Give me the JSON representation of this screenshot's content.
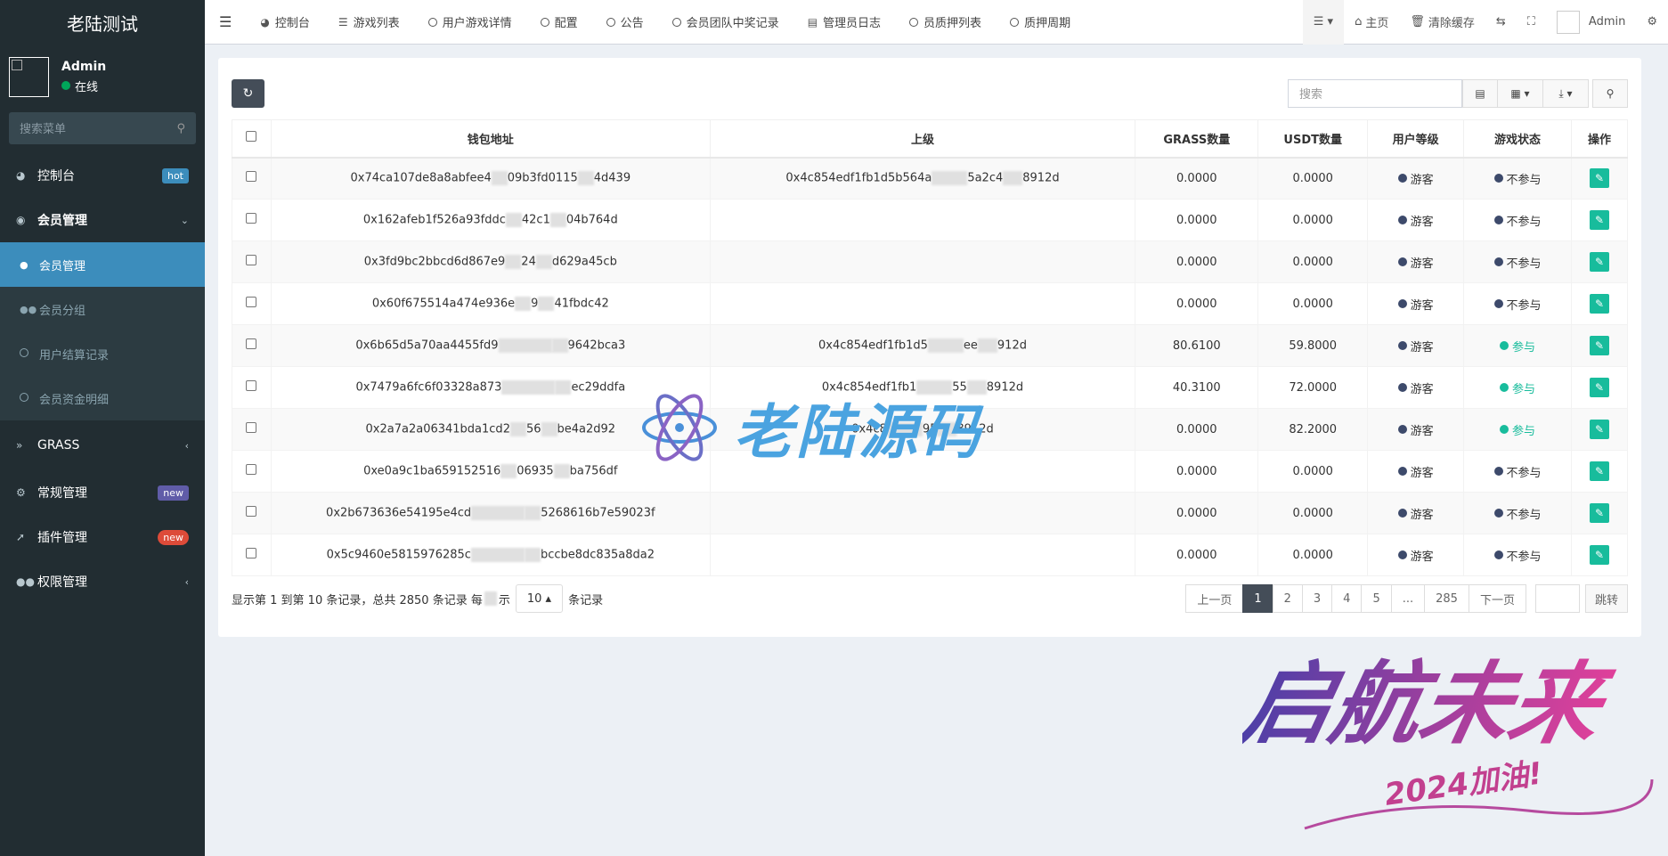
{
  "brand": "老陆测试",
  "user": {
    "name": "Admin",
    "status": "在线"
  },
  "side_search_placeholder": "搜索菜单",
  "sidebar": {
    "dashboard": {
      "label": "控制台",
      "badge": "hot"
    },
    "member_mgmt": {
      "label": "会员管理"
    },
    "sub": [
      {
        "label": "会员管理"
      },
      {
        "label": "会员分组"
      },
      {
        "label": "用户结算记录"
      },
      {
        "label": "会员资金明细"
      }
    ],
    "grass": {
      "label": "GRASS"
    },
    "general": {
      "label": "常规管理",
      "badge": "new"
    },
    "plugins": {
      "label": "插件管理",
      "badge": "new"
    },
    "permissions": {
      "label": "权限管理"
    }
  },
  "tabs": [
    "控制台",
    "游戏列表",
    "用户游戏详情",
    "配置",
    "公告",
    "会员团队中奖记录",
    "管理员日志",
    "员质押列表",
    "质押周期"
  ],
  "topright": {
    "home": "主页",
    "clear_cache": "清除缓存",
    "admin": "Admin"
  },
  "search_placeholder": "搜索",
  "table": {
    "headers": [
      "钱包地址",
      "上级",
      "GRASS数量",
      "USDT数量",
      "用户等级",
      "游戏状态",
      "操作"
    ],
    "rows": [
      {
        "wallet": "0x74ca107de8a8abfee4",
        "wallet_end": "09b3fd0115",
        "wallet_tail": "4d439",
        "parent": "0x4c854edf1fb1d5b564a",
        "parent_end": "5a2c4",
        "parent_tail": "8912d",
        "grass": "0.0000",
        "usdt": "0.0000",
        "level": "游客",
        "state": "不参与"
      },
      {
        "wallet": "0x162afeb1f526a93fddc",
        "wallet_end": "42c1",
        "wallet_tail": "04b764d",
        "parent": "",
        "parent_end": "",
        "parent_tail": "",
        "grass": "0.0000",
        "usdt": "0.0000",
        "level": "游客",
        "state": "不参与"
      },
      {
        "wallet": "0x3fd9bc2bbcd6d867e9",
        "wallet_end": "24",
        "wallet_tail": "d629a45cb",
        "parent": "",
        "parent_end": "",
        "parent_tail": "",
        "grass": "0.0000",
        "usdt": "0.0000",
        "level": "游客",
        "state": "不参与"
      },
      {
        "wallet": "0x60f675514a474e936e",
        "wallet_end": "9",
        "wallet_tail": "41fbdc42",
        "parent": "",
        "parent_end": "",
        "parent_tail": "",
        "grass": "0.0000",
        "usdt": "0.0000",
        "level": "游客",
        "state": "不参与"
      },
      {
        "wallet": "0x6b65d5a70aa4455fd9",
        "wallet_end": "",
        "wallet_tail": "9642bca3",
        "parent": "0x4c854edf1fb1d5",
        "parent_end": "ee",
        "parent_tail": "912d",
        "grass": "80.6100",
        "usdt": "59.8000",
        "level": "游客",
        "state": "参与"
      },
      {
        "wallet": "0x7479a6fc6f03328a873",
        "wallet_end": "",
        "wallet_tail": "ec29ddfa",
        "parent": "0x4c854edf1fb1",
        "parent_end": "55",
        "parent_tail": "8912d",
        "grass": "40.3100",
        "usdt": "72.0000",
        "level": "游客",
        "state": "参与"
      },
      {
        "wallet": "0x2a7a2a06341bda1cd2",
        "wallet_end": "56",
        "wallet_tail": "be4a2d92",
        "parent": "0x4c8",
        "parent_end": "95",
        "parent_tail": "8912d",
        "grass": "0.0000",
        "usdt": "82.2000",
        "level": "游客",
        "state": "参与"
      },
      {
        "wallet": "0xe0a9c1ba659152516",
        "wallet_end": "06935",
        "wallet_tail": "ba756df",
        "parent": "",
        "parent_end": "",
        "parent_tail": "",
        "grass": "0.0000",
        "usdt": "0.0000",
        "level": "游客",
        "state": "不参与"
      },
      {
        "wallet": "0x2b673636e54195e4cd",
        "wallet_end": "",
        "wallet_tail": "5268616b7e59023f",
        "parent": "",
        "parent_end": "",
        "parent_tail": "",
        "grass": "0.0000",
        "usdt": "0.0000",
        "level": "游客",
        "state": "不参与"
      },
      {
        "wallet": "0x5c9460e5815976285c",
        "wallet_end": "",
        "wallet_tail": "bccbe8dc835a8da2",
        "parent": "",
        "parent_end": "",
        "parent_tail": "",
        "grass": "0.0000",
        "usdt": "0.0000",
        "level": "游客",
        "state": "不参与"
      }
    ]
  },
  "footer": {
    "summary_before": "显示第 1 到第 10 条记录，总共 2850 条记录 每",
    "summary_mid": "示",
    "page_size": "10",
    "summary_after": "条记录"
  },
  "pagination": {
    "prev": "上一页",
    "pages": [
      "1",
      "2",
      "3",
      "4",
      "5",
      "...",
      "285"
    ],
    "next": "下一页",
    "jump": "跳转"
  },
  "watermark_center": "老陆源码",
  "watermark_corner": {
    "main": "启航未来",
    "sub": "2024加油!"
  },
  "colors": {
    "sidebar": "#222d32",
    "active": "#3c8dbc",
    "edit": "#18bc9c",
    "refresh": "#444d58"
  }
}
